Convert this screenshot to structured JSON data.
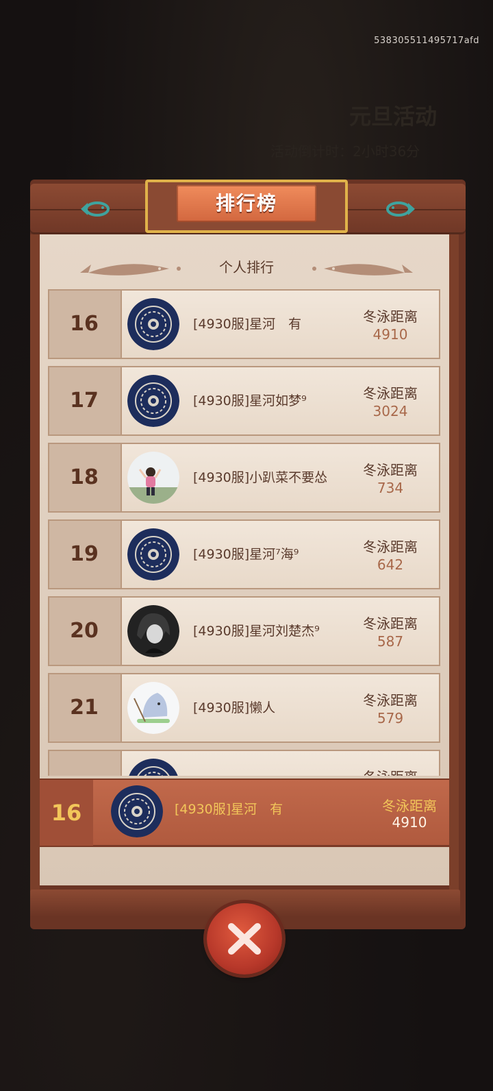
{
  "header": {
    "uid": "538305511495717afd"
  },
  "background": {
    "event_title": "元旦活动",
    "countdown_text": "活动倒计时：2小时36分"
  },
  "title": "排行榜",
  "section_title": "个人排行",
  "stat_label": "冬泳距离",
  "rows": [
    {
      "rank": "16",
      "name": "[4930服]星河　有",
      "value": "4910",
      "avatar": "emblem-avatar"
    },
    {
      "rank": "17",
      "name": "[4930服]星河如梦⁹",
      "value": "3024",
      "avatar": "emblem-avatar"
    },
    {
      "rank": "18",
      "name": "[4930服]小趴菜不要怂",
      "value": "734",
      "avatar": "child-photo-avatar"
    },
    {
      "rank": "19",
      "name": "[4930服]星河⁷海⁹",
      "value": "642",
      "avatar": "emblem-avatar"
    },
    {
      "rank": "20",
      "name": "[4930服]星河刘楚杰⁹",
      "value": "587",
      "avatar": "dark-character-avatar"
    },
    {
      "rank": "21",
      "name": "[4930服]懒人",
      "value": "579",
      "avatar": "shark-avatar"
    },
    {
      "rank": "",
      "name": "",
      "value": "",
      "avatar": "emblem-avatar"
    }
  ],
  "my_rank": {
    "rank": "16",
    "name": "[4930服]星河　有",
    "label": "冬泳距离",
    "value": "4910"
  },
  "colors": {
    "accent": "#f2c65a",
    "banner": "#e37a4c",
    "parchment": "#e6d7c8",
    "wood": "#7b3f2a"
  },
  "icons": {
    "close": "close-icon",
    "fish": "fish-icon"
  }
}
